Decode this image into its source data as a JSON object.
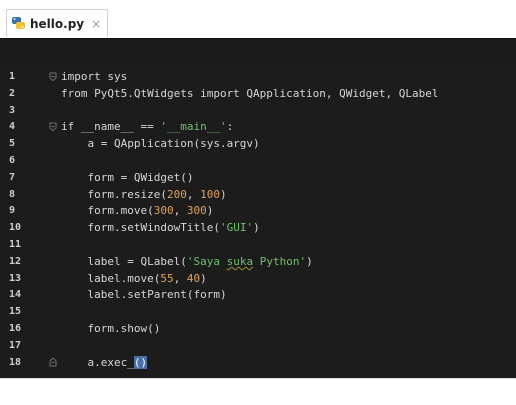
{
  "tab": {
    "filename": "hello.py",
    "close_glyph": "×",
    "icon": "python-file-icon"
  },
  "colors": {
    "editor_bg": "#1c1c1c",
    "text": "#d6d6d6",
    "number": "#e0a25a",
    "string": "#6fc36a",
    "paren_highlight": "#4b6fa6"
  },
  "lines": [
    {
      "num": "1",
      "parts": [
        {
          "t": "import sys"
        }
      ]
    },
    {
      "num": "2",
      "parts": [
        {
          "t": "from PyQt5.QtWidgets import QApplication, QWidget, QLabel"
        }
      ]
    },
    {
      "num": "3",
      "parts": []
    },
    {
      "num": "4",
      "parts": [
        {
          "t": "if __name__ == "
        },
        {
          "t": "'__main__'",
          "c": "str"
        },
        {
          "t": ":"
        }
      ]
    },
    {
      "num": "5",
      "parts": [
        {
          "t": "    a = QApplication(sys.argv)"
        }
      ]
    },
    {
      "num": "6",
      "parts": []
    },
    {
      "num": "7",
      "parts": [
        {
          "t": "    form = QWidget()"
        }
      ]
    },
    {
      "num": "8",
      "parts": [
        {
          "t": "    form.resize("
        },
        {
          "t": "200",
          "c": "num"
        },
        {
          "t": ", "
        },
        {
          "t": "100",
          "c": "num"
        },
        {
          "t": ")"
        }
      ]
    },
    {
      "num": "9",
      "parts": [
        {
          "t": "    form.move("
        },
        {
          "t": "300",
          "c": "num"
        },
        {
          "t": ", "
        },
        {
          "t": "300",
          "c": "num"
        },
        {
          "t": ")"
        }
      ]
    },
    {
      "num": "10",
      "parts": [
        {
          "t": "    form.setWindowTitle("
        },
        {
          "t": "'GUI'",
          "c": "str"
        },
        {
          "t": ")"
        }
      ]
    },
    {
      "num": "11",
      "parts": []
    },
    {
      "num": "12",
      "parts": [
        {
          "t": "    label = QLabel("
        },
        {
          "t": "'Saya ",
          "c": "str"
        },
        {
          "t": "suka",
          "c": "str squig"
        },
        {
          "t": " Python'",
          "c": "str"
        },
        {
          "t": ")"
        }
      ]
    },
    {
      "num": "13",
      "parts": [
        {
          "t": "    label.move("
        },
        {
          "t": "55",
          "c": "num"
        },
        {
          "t": ", "
        },
        {
          "t": "40",
          "c": "num"
        },
        {
          "t": ")"
        }
      ]
    },
    {
      "num": "14",
      "parts": [
        {
          "t": "    label.setParent(form)"
        }
      ]
    },
    {
      "num": "15",
      "parts": []
    },
    {
      "num": "16",
      "parts": [
        {
          "t": "    form.show()"
        }
      ]
    },
    {
      "num": "17",
      "parts": []
    },
    {
      "num": "18",
      "parts": [
        {
          "t": "    a.exec_"
        },
        {
          "t": "()",
          "c": "paren"
        }
      ]
    }
  ],
  "folds": [
    "1",
    "4",
    "18"
  ]
}
